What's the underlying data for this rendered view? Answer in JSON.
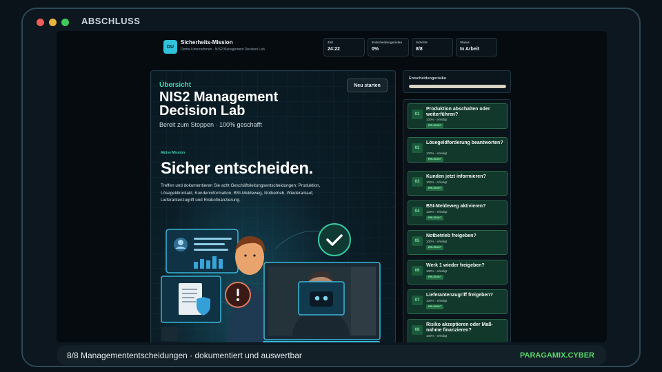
{
  "window": {
    "title": "ABSCHLUSS"
  },
  "header": {
    "logo": "DU",
    "title": "Sicherheits-Mission",
    "subtitle": "Demo-Unternehmen · NIS2 Management Decision Lab",
    "stats": [
      {
        "label": "Zeit",
        "value": "24:22"
      },
      {
        "label": "Entscheidungsrisiko",
        "value": "0%"
      },
      {
        "label": "Schritte",
        "value": "8/8"
      },
      {
        "label": "Status",
        "value": "In Arbeit"
      }
    ]
  },
  "hero": {
    "overview_label": "Übersicht",
    "title": "NIS2 Management Decision Lab",
    "subtitle": "Bereit zum Stoppen · 100% geschafft",
    "start_button": "Neu starten",
    "mission_label": "Aktive Mission",
    "mission_title": "Sicher entscheiden.",
    "mission_description": "Treffen und dokumentieren Sie acht Geschäftsleitungsentscheidungen: Produktion, Lösegeldkontakt, Kundeninformation, BSI-Meldeweg, Notbetrieb, Wiederanlauf, Lieferantenzugriff und Risikofinanzierung."
  },
  "risk": {
    "label": "Entscheidungsrisiko",
    "level": 1.0
  },
  "steps": [
    {
      "num": "01",
      "title": "Produktion abschalten oder weiterführen?",
      "meta": "100% · erledigt",
      "badge": "ERLEDIGT"
    },
    {
      "num": "02",
      "title": "Lösegeldforderung beantworten?",
      "meta": "100% · erledigt",
      "badge": "ERLEDIGT"
    },
    {
      "num": "03",
      "title": "Kunden jetzt informieren?",
      "meta": "100% · erledigt",
      "badge": "ERLEDIGT"
    },
    {
      "num": "04",
      "title": "BSI-Meldeweg aktivieren?",
      "meta": "100% · erledigt",
      "badge": "ERLEDIGT"
    },
    {
      "num": "05",
      "title": "Notbetrieb freigeben?",
      "meta": "100% · erledigt",
      "badge": "ERLEDIGT"
    },
    {
      "num": "06",
      "title": "Werk 1 wieder freigeben?",
      "meta": "100% · erledigt",
      "badge": "ERLEDIGT"
    },
    {
      "num": "07",
      "title": "Lieferantenzugriff freigeben?",
      "meta": "100% · erledigt",
      "badge": "ERLEDIGT"
    },
    {
      "num": "08",
      "title": "Risiko akzeptieren oder Maß-nahme finanzieren?",
      "meta": "100% · erledigt",
      "badge": ""
    }
  ],
  "footer": {
    "text": "8/8 Managemententscheidungen · dokumentiert und auswertbar",
    "brand": "PARAGAMIX.CYBER"
  },
  "colors": {
    "accent": "#3fd7b4",
    "success": "#57d56a",
    "step_bg": "#11382a"
  }
}
